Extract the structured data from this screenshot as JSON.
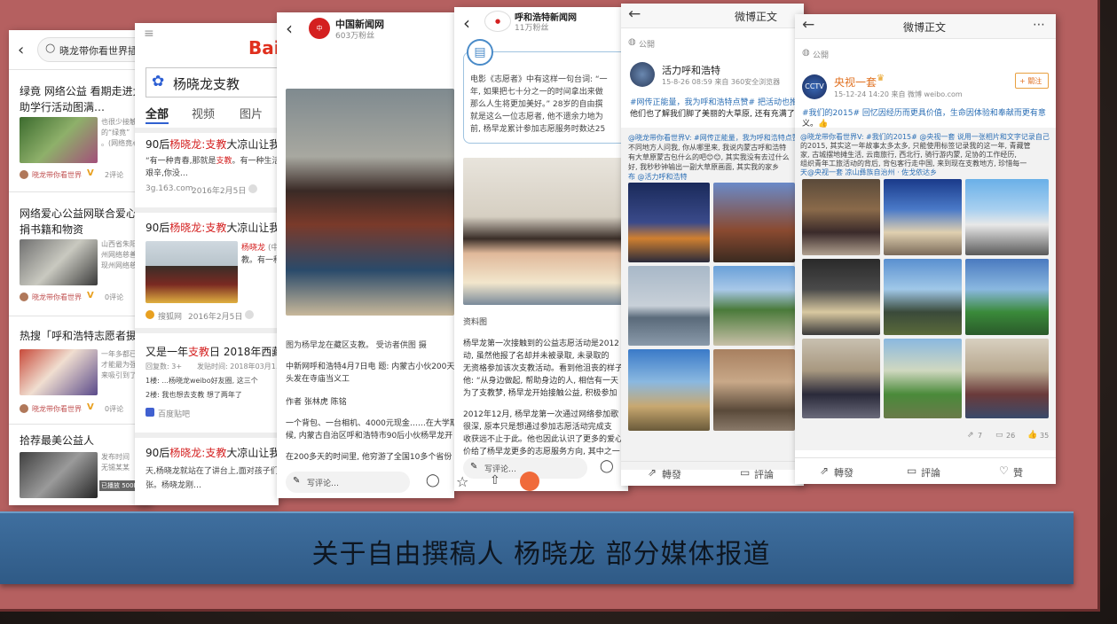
{
  "caption": "关于自由撰稿人 杨晓龙 部分媒体报道",
  "card1": {
    "search": "晓龙带你看世界插",
    "items": [
      {
        "title1": "绿竟 网络公益 看期走进大",
        "title2": "助学行活动图满…",
        "snip1": "也很少接触和",
        "snip2": "的“绿竟”",
        "snip3": "。(网络竟心公益",
        "meta": "晓龙带你看世界",
        "cmt": "2评论"
      },
      {
        "title1": "网络爱心公益网联合爱心人",
        "title2": "捐书籍和物资",
        "snip1": "山西省朱阳",
        "snip2": "州网络慈善会",
        "snip3": "现州网络慈善",
        "meta": "晓龙带你看世界",
        "cmt": "0评论"
      },
      {
        "title1": "热搜「呼和浩特志愿者摄影",
        "title2": "",
        "snip1": "一年多都已经",
        "snip2": "才能最为强…",
        "snip3": "来吸引到了",
        "meta": "晓龙带你看世界",
        "cmt": "0评论"
      },
      {
        "title1": "拾荐最美公益人",
        "title2": "",
        "snip1": "发布时间",
        "snip2": "无锡某某",
        "snip3": "已播放 500M",
        "meta": "",
        "cmt": ""
      }
    ]
  },
  "card2": {
    "logo": "Bai",
    "query": "杨晓龙支教",
    "tabs": [
      "全部",
      "视频",
      "图片"
    ],
    "results": [
      {
        "t1": "90后",
        "t2": "杨晓龙:支教",
        "t3": "大凉山让我",
        "s1": "“有一种青春,那就是",
        "s1b": "支教",
        "s1c": "。有一种生活",
        "s2": "艰辛,你没…",
        "src": "3g.163.com",
        "date": "2016年2月5日"
      },
      {
        "t1": "90后",
        "t2": "杨晓龙:支教",
        "t3": "大凉山让我",
        "s1": "杨晓龙",
        "s1b": "(中",
        "s1c": "",
        "s2": "教。有一种",
        "src": "搜狐网",
        "date": "2016年2月5日"
      },
      {
        "t1": "又是一年",
        "t2": "支教",
        "t3": "日 2018年西藏",
        "s1": "回复数: 3+",
        "s1b": "发贴时间: 2018年03月1…",
        "s1c": "",
        "s2": "1楼: ...杨晓龙weibo好友圈, 这三个",
        "s3": "2楼: 我也想去支教 想了两年了",
        "src": "百度贴吧",
        "date": ""
      },
      {
        "t1": "90后",
        "t2": "杨晓龙:支教",
        "t3": "大凉山让我",
        "s1": "天,杨晓龙就站在了讲台上,面对孩子们",
        "s1b": "",
        "s1c": "",
        "s2": "张。杨晓龙刚…",
        "src": "",
        "date": ""
      }
    ]
  },
  "card3": {
    "name": "中国新闻网",
    "fans": "603万粉丝",
    "cap": "图为杨早龙在藏区支教。 受访者供图 摄",
    "p1": "中新网呼和浩特4月7日电 题: 内蒙古小伙200天",
    "p1b": "头发在寺庙当义工",
    "author": "作者 张林虎 陈铭",
    "p2": "一个背包、一台相机、4000元现金……在大学期",
    "p2b": "候, 内蒙古自治区呼和浩特市90后小伙杨早龙开",
    "p3": "在200多天的时间里, 他穷游了全国10多个省份",
    "comment": "写评论…"
  },
  "card4": {
    "name": "呼和浩特新闻网",
    "fans": "11万粉丝",
    "quote1": "电影《志愿者》中有这样一句台词: “一",
    "quote2": "年, 如果把七十分之一的时间拿出来做",
    "quote3": "那么人生将更加美好。” 28岁的自由撰",
    "quote4": "就是这么一位志愿者, 他不遗余力地为",
    "quote5": "前, 杨早龙累计参加志愿服务时数达25",
    "cap": "资料图",
    "p1": "杨早龙第一次接触到的公益志愿活动是2012",
    "p2": "动, 虽然他报了名却并未被录取, 未录取的",
    "p3": "无资格参加该次支教活动。看到他沮丧的样子",
    "p4": "他: “从身边做起, 帮助身边的人, 相信有一天",
    "p5": "为了支教梦, 杨早龙开始接触公益, 积极参加",
    "p6": "2012年12月, 杨早龙第一次通过网络参加歌",
    "p7": "很深, 原本只是想通过参加志愿活动完成支",
    "p8": "收获远不止于此。他也因此认识了更多的爱心",
    "p9": "价给了杨早龙更多的志愿服务方向, 其中之一",
    "comment": "写评论…"
  },
  "card5": {
    "header": "微博正文",
    "public": "公開",
    "name": "活力呼和浩特",
    "meta": "15-8-26 08:59  来自 360安全浏览器",
    "txt1": "#网传正能量，我为呼和浩特点赞# 把活动也推",
    "txt2": "他们也了解我们脚了美丽的大草原, 还有充满了",
    "rt1": "@晓龙带你看世界V: #网传正能量，我为呼和浩特点赞",
    "rt2": "不同地方人问我, 你从哪里来, 我说内蒙古呼和浩特",
    "rt3": "有大草原蒙古包什么的吧😊😊, 其实我没有去过什么",
    "rt4": "好, 我秒秒钟输出一副大草原画面, 其实我的家乡",
    "rt5": "布 @活力呼和浩特",
    "repost": "轉發",
    "comment": "評論"
  },
  "card6": {
    "header": "微博正文",
    "public": "公開",
    "name": "央视一套",
    "follow": "+ 關注",
    "meta": "15-12-24 14:20  来自 微博 weibo.com",
    "txt1": "#我们的2015# 回忆因经历而更具价值，生命因体验和奉献而更有意",
    "txt2": "义。👍",
    "rt1": "@晓龙带你看世界V: #我们的2015# @央视一套 说用一张相片和文字记录自己",
    "rt2": "的2015, 其实这一年故事太多太多, 只能使用标签记录我的这一年, 青藏管",
    "rt3": "家, 古城摆地摊生活, 云南旅行, 西北行, 骑行游内蒙, 足协的工作经历,",
    "rt4": "组织青年工旅活动的背后, 背包客行走中国, 来到现在支教地方, 珍惜每一",
    "rt5": "天@央视一套   凉山彝族自治州 · 佐戈依达乡",
    "stat_repost": "7",
    "stat_comment": "26",
    "stat_like": "35",
    "repost": "轉發",
    "comment": "評論",
    "like": "贊"
  }
}
